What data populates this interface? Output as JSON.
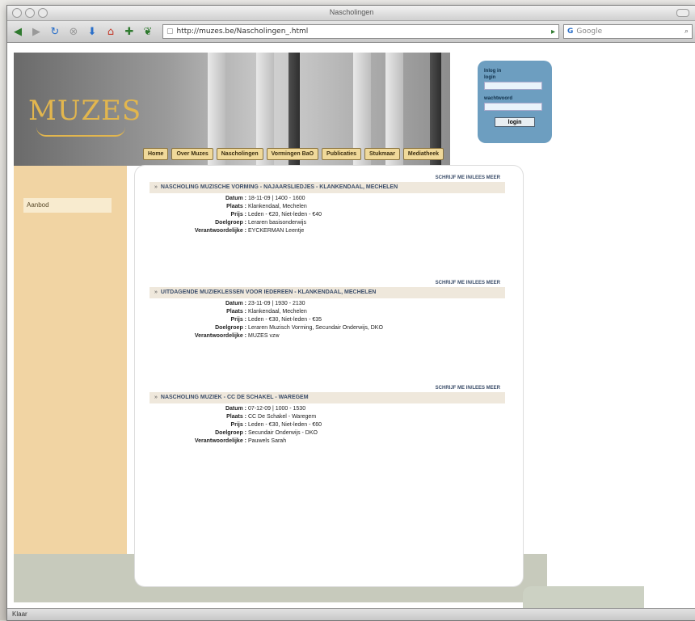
{
  "window": {
    "title": "Nascholingen",
    "status": "Klaar"
  },
  "toolbar": {
    "url": "http://muzes.be/Nascholingen_.html",
    "search_placeholder": "Google"
  },
  "site": {
    "logo": "MUZES",
    "nav": [
      "Home",
      "Over Muzes",
      "Nascholingen",
      "Vormingen BaO",
      "Publicaties",
      "Stukmaar",
      "Mediatheek"
    ],
    "login": {
      "heading": "Inlog in",
      "user_label": "login",
      "pass_label": "wachtwoord",
      "button": "login"
    },
    "sidebar": {
      "item": "Aanbod"
    }
  },
  "entries": [
    {
      "title": "Nascholing muzische vorming - najaarsliedjes - klankendaal, Mechelen",
      "link": "schrijf me in/lees meer",
      "fields": [
        {
          "k": "Datum :",
          "v": "18-11-09 | 1400 - 1600"
        },
        {
          "k": "Plaats :",
          "v": "Klankendaal, Mechelen"
        },
        {
          "k": "Prijs :",
          "v": "Leden - €20, Niet-leden - €40"
        },
        {
          "k": "Doelgroep :",
          "v": "Leraren basisonderwijs"
        },
        {
          "k": "Verantwoordelijke :",
          "v": "EYCKERMAN Leentje"
        }
      ]
    },
    {
      "title": "Uitdagende muzieklessen voor iedereen - klankendaal, Mechelen",
      "link": "schrijf me in/lees meer",
      "fields": [
        {
          "k": "Datum :",
          "v": "23-11-09 | 1930 - 2130"
        },
        {
          "k": "Plaats :",
          "v": "Klankendaal, Mechelen"
        },
        {
          "k": "Prijs :",
          "v": "Leden - €30, Niet-leden - €35"
        },
        {
          "k": "Doelgroep :",
          "v": "Leraren Muzisch Vorming, Secundair Onderwijs, DKO"
        },
        {
          "k": "Verantwoordelijke :",
          "v": "MUZES vzw"
        }
      ]
    },
    {
      "title": "Nascholing muziek - cc de schakel - Waregem",
      "link": "schrijf me in/lees meer",
      "fields": [
        {
          "k": "Datum :",
          "v": "07-12-09 | 1000 - 1530"
        },
        {
          "k": "Plaats :",
          "v": "CC De Schakel - Waregem"
        },
        {
          "k": "Prijs :",
          "v": "Leden - €30, Niet-leden - €60"
        },
        {
          "k": "Doelgroep :",
          "v": "Secundair Onderwijs - DKO"
        },
        {
          "k": "Verantwoordelijke :",
          "v": "Pauwels Sarah"
        }
      ]
    }
  ]
}
